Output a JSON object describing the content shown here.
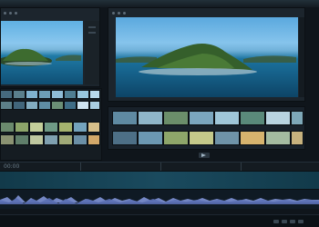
{
  "timeline": {
    "timecode": "00:00"
  },
  "colors": {
    "accent": "#2f7fb0",
    "waveform": "#7f93d6",
    "sky": "#4a9ed4",
    "sea": "#1d6f99"
  },
  "icons": [
    "menu-dots-icon",
    "play-icon",
    "island-thumbnail",
    "waveform-icon"
  ]
}
